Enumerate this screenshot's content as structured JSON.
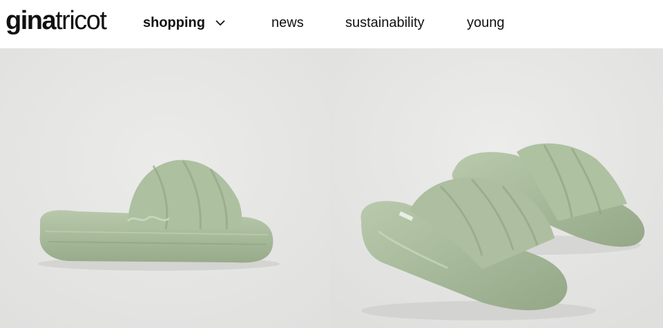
{
  "brand": {
    "logo_bold": "gina",
    "logo_light": "tricot"
  },
  "nav": {
    "items": [
      {
        "label": "shopping",
        "has_dropdown": true
      },
      {
        "label": "news"
      },
      {
        "label": "sustainability"
      },
      {
        "label": "young"
      }
    ]
  },
  "gallery": {
    "images": [
      {
        "subject": "single green faux-fur slide slipper, side view"
      },
      {
        "subject": "pair of green faux-fur slide slippers, angled view"
      }
    ],
    "colors": {
      "background": "#e6e6e5",
      "product": "#a9bd9c"
    }
  }
}
